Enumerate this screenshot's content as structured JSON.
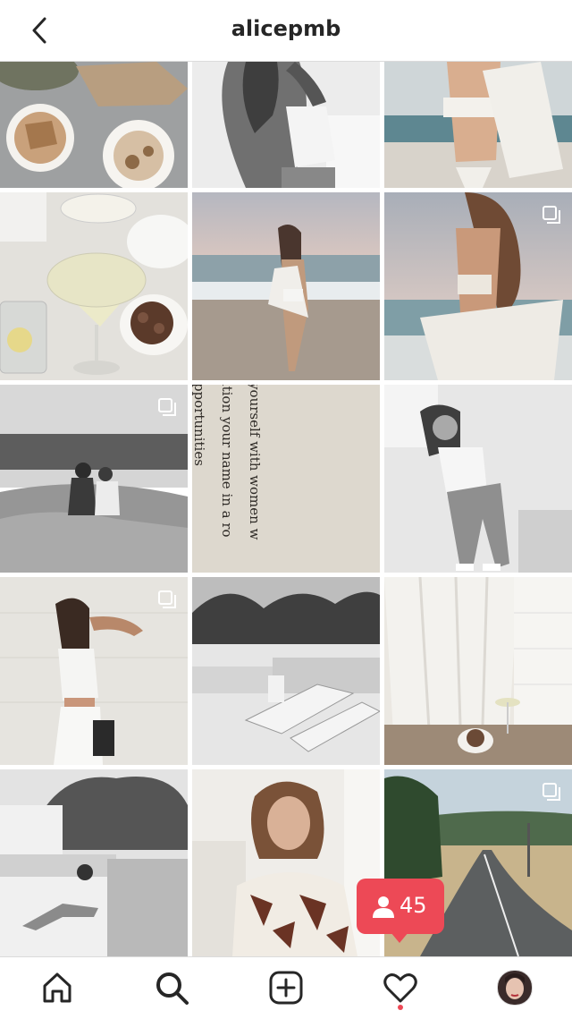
{
  "header": {
    "title": "alicepmb",
    "back_icon": "chevron-left-icon"
  },
  "grid": {
    "tiles": [
      {
        "desc": "coffee cups on table",
        "multi": false
      },
      {
        "desc": "woman touching hair bw",
        "multi": false
      },
      {
        "desc": "woman in white bikini and shirt at beach",
        "multi": false
      },
      {
        "desc": "drinks and olives on table",
        "multi": false
      },
      {
        "desc": "woman walking on beach",
        "multi": false
      },
      {
        "desc": "woman with white shirt by sea",
        "multi": true
      },
      {
        "desc": "two people sitting on rocks by sea",
        "multi": true
      },
      {
        "desc": "book page text",
        "multi": false
      },
      {
        "desc": "woman sitting on chair bw",
        "multi": false
      },
      {
        "desc": "woman leaning on wall",
        "multi": true
      },
      {
        "desc": "rooftop with sun loungers bw",
        "multi": false
      },
      {
        "desc": "curtain, drink and olives on floor",
        "multi": false
      },
      {
        "desc": "woman lying on white terrace bw",
        "multi": false
      },
      {
        "desc": "smiling woman in patterned shirt",
        "multi": false
      },
      {
        "desc": "country road with trees",
        "multi": true
      }
    ],
    "book_text": [
      "rround yourself with women w",
      "uld mention your name in a ro",
      "full of opportunities"
    ]
  },
  "notification": {
    "count": "45",
    "icon": "person-icon",
    "color": "#ed4956"
  },
  "nav": {
    "items": [
      "home-icon",
      "search-icon",
      "add-icon",
      "heart-icon",
      "profile-avatar"
    ],
    "active_dot_color": "#ed4956"
  }
}
